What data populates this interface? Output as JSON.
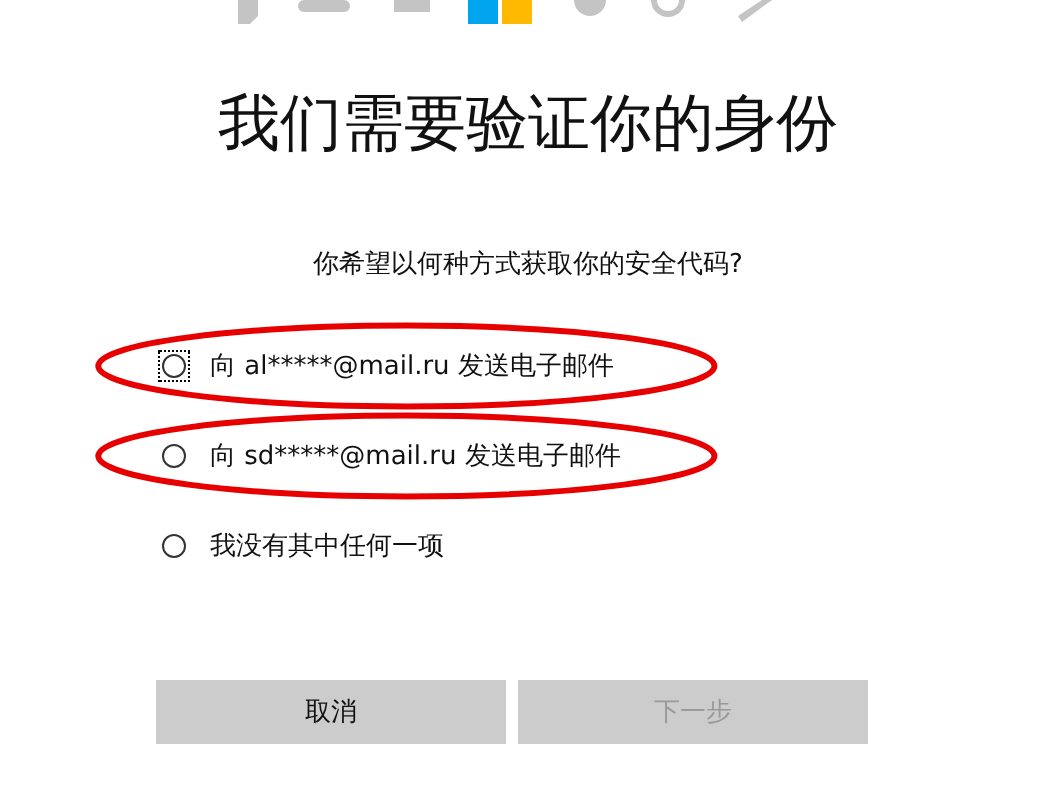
{
  "title": "我们需要验证你的身份",
  "prompt": "你希望以何种方式获取你的安全代码?",
  "options": [
    {
      "label": "向 al*****@mail.ru 发送电子邮件",
      "selected": false,
      "focused": true,
      "highlighted": true
    },
    {
      "label": "向 sd*****@mail.ru 发送电子邮件",
      "selected": false,
      "focused": false,
      "highlighted": true
    },
    {
      "label": "我没有其中任何一项",
      "selected": false,
      "focused": false,
      "highlighted": false
    }
  ],
  "buttons": [
    {
      "label": "取消",
      "disabled": false
    },
    {
      "label": "下一步",
      "disabled": true
    }
  ]
}
